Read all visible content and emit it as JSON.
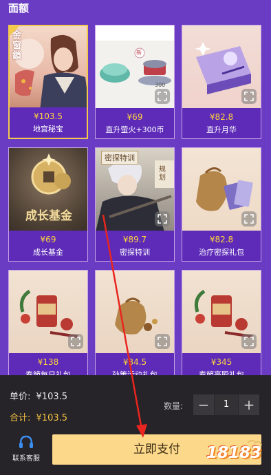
{
  "section_title": "面额",
  "cards": [
    {
      "price": "¥103.5",
      "name": "地宫秘宝",
      "selected": true
    },
    {
      "price": "¥69",
      "name": "直升萤火+300币",
      "selected": false
    },
    {
      "price": "¥82.8",
      "name": "直升月华",
      "selected": false
    },
    {
      "price": "¥69",
      "name": "成长基金",
      "selected": false
    },
    {
      "price": "¥89.7",
      "name": "密探特训",
      "selected": false
    },
    {
      "price": "¥82.8",
      "name": "治疗密探礼包",
      "selected": false
    },
    {
      "price": "¥138",
      "name": "春節每日礼包",
      "selected": false
    },
    {
      "price": "¥34.5",
      "name": "孙策活动礼包",
      "selected": false
    },
    {
      "price": "¥345",
      "name": "春節豪殿礼包",
      "selected": false
    }
  ],
  "art_text": {
    "card1_vertical": "金窗鎖",
    "card2_badge": "新",
    "card2_number": "300",
    "card4_caption": "成长基金",
    "card5_banner": "密探特训",
    "card5_side": "规划"
  },
  "summary": {
    "unit_label": "单价:",
    "unit_value": "¥103.5",
    "total_label": "合计:",
    "total_value": "¥103.5"
  },
  "quantity": {
    "label": "数量:",
    "minus": "−",
    "value": "1",
    "plus": "+"
  },
  "service": {
    "label": "联系客服",
    "icon": "headset-icon"
  },
  "pay_label": "立即支付",
  "watermark": "18183",
  "colors": {
    "background": "#6a3cc4",
    "card_info": "#5d2bb8",
    "price": "#ffd43b",
    "pay_button": "#fcd88a",
    "panel": "#262329",
    "annotation_arrow": "#e8261f"
  }
}
